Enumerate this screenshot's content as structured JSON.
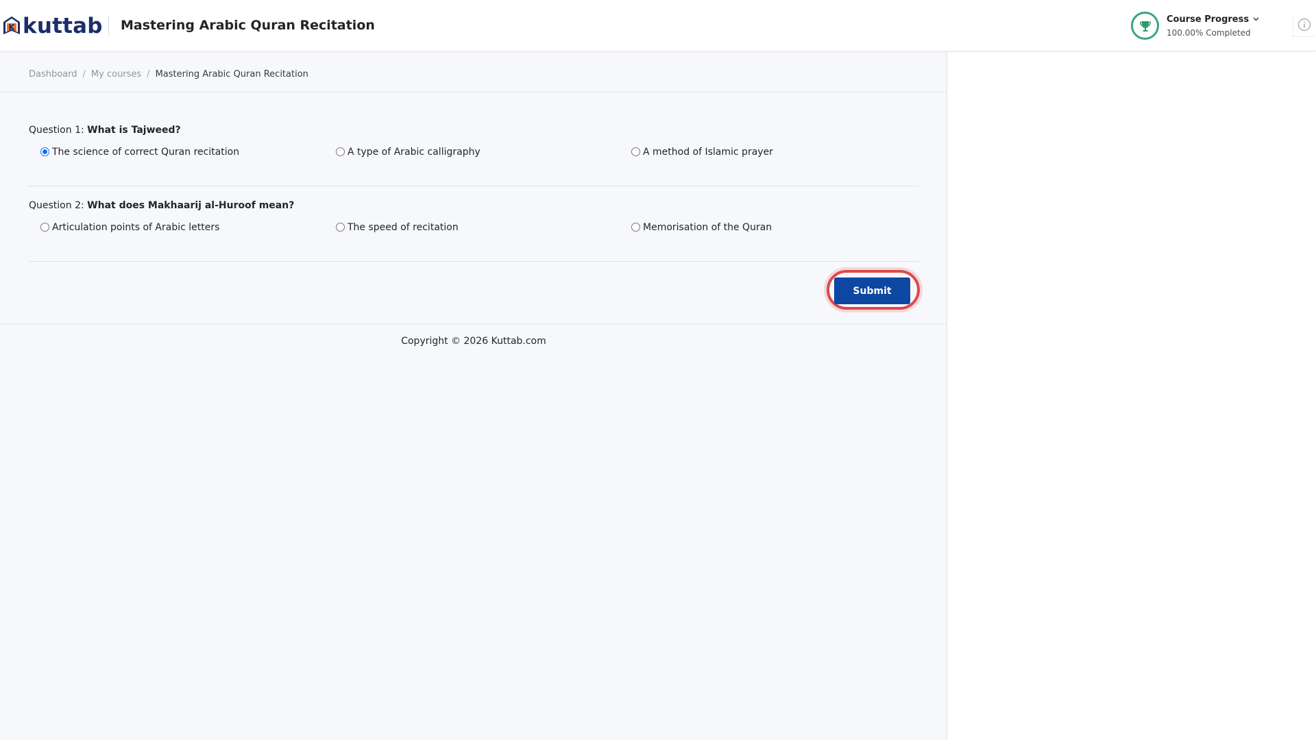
{
  "header": {
    "logo_text": "kuttab",
    "logo_badge_letter": "K",
    "course_title": "Mastering Arabic Quran Recitation",
    "progress": {
      "label": "Course Progress",
      "value_text": "100.00% Completed",
      "percent": 100,
      "ring_color": "#3aa57a",
      "icon": "trophy-icon"
    },
    "info_icon": "info-icon"
  },
  "breadcrumb": {
    "items": [
      "Dashboard",
      "My courses"
    ],
    "separator": "/",
    "current": "Mastering Arabic Quran Recitation"
  },
  "questions": [
    {
      "prefix": "Question 1:",
      "text": "What is Tajweed?",
      "options": [
        "The science of correct Quran recitation",
        "A type of Arabic calligraphy",
        "A method of Islamic prayer"
      ],
      "selected": 0
    },
    {
      "prefix": "Question 2:",
      "text": "What does Makhaarij al-Huroof mean?",
      "options": [
        "Articulation points of Arabic letters",
        "The speed of recitation",
        "Memorisation of the Quran"
      ],
      "selected": null
    }
  ],
  "submit_label": "Submit",
  "footer_text": "Copyright © 2026 Kuttab.com",
  "colors": {
    "brand": "#1b2e6b",
    "submit": "#0d47a1",
    "highlight": "#e0474c",
    "radio_checked": "#0d6efd"
  }
}
